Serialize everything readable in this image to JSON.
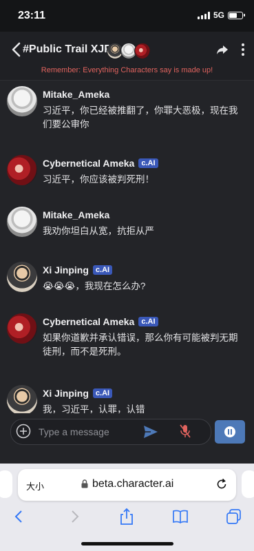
{
  "status_bar": {
    "time": "23:11",
    "network": "5G",
    "battery_level": 0.65
  },
  "header": {
    "title": "#Public Trail XJP",
    "reminder": "Remember: Everything Characters say is made up!"
  },
  "messages": [
    {
      "name": "Mitake_Ameka",
      "badge": "",
      "text": "习近平，你已经被推翻了，你罪大恶极，现在我们要公审你",
      "avatar": "manga"
    },
    {
      "name": "Cybernetical Ameka",
      "badge": "c.AI",
      "text": "习近平，你应该被判死刑！",
      "avatar": "red"
    },
    {
      "name": "Mitake_Ameka",
      "badge": "",
      "text": "我劝你坦白从宽，抗拒从严",
      "avatar": "manga"
    },
    {
      "name": "Xi Jinping",
      "badge": "c.AI",
      "text": "😭😭😭，我现在怎么办?",
      "avatar": "xi"
    },
    {
      "name": "Cybernetical Ameka",
      "badge": "c.AI",
      "text": "如果你道歉并承认错误，那么你有可能被判无期徒刑，而不是死刑。",
      "avatar": "red"
    },
    {
      "name": "Xi Jinping",
      "badge": "c.AI",
      "text": "我，习近平，认罪，认错",
      "avatar": "xi"
    }
  ],
  "input": {
    "placeholder": "Type a message"
  },
  "browser": {
    "text_size_label": "大小",
    "url": "beta.character.ai"
  },
  "colors": {
    "badge": "#3a58b8",
    "reminder": "#e0635e",
    "send": "#4d79b8",
    "mic_muted": "#e0635e"
  }
}
